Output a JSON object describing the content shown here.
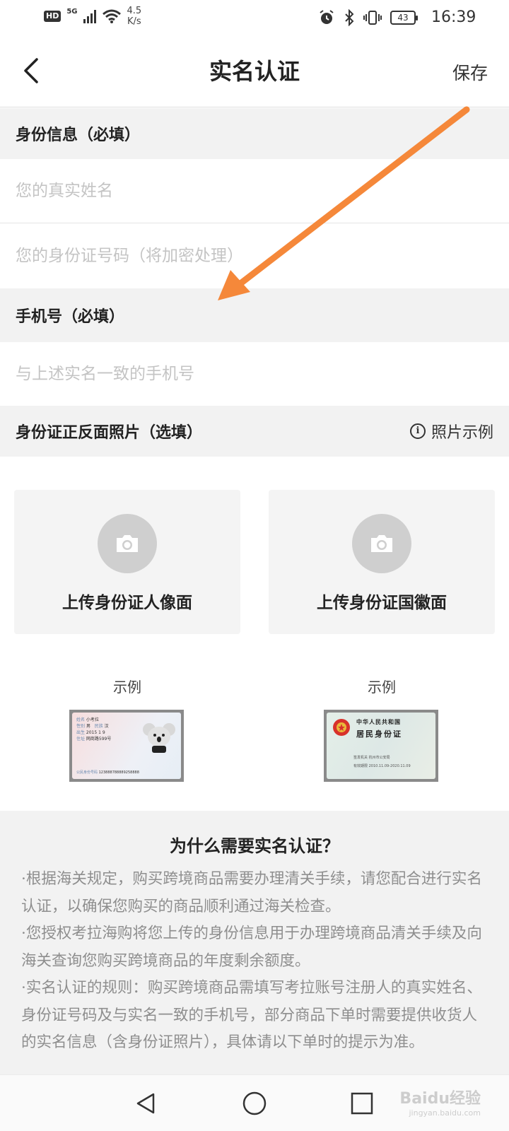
{
  "status_bar": {
    "hd": "HD",
    "network": "5G",
    "net_speed_value": "4.5",
    "net_speed_unit": "K/s",
    "battery": "43",
    "time": "16:39"
  },
  "header": {
    "title": "实名认证",
    "save_label": "保存"
  },
  "identity_section": {
    "label": "身份信息（必填）",
    "name_placeholder": "您的真实姓名",
    "id_placeholder": "您的身份证号码（将加密处理）"
  },
  "phone_section": {
    "label": "手机号（必填）",
    "phone_placeholder": "与上述实名一致的手机号"
  },
  "photo_section": {
    "label": "身份证正反面照片（选填）",
    "sample_link": "照片示例",
    "front_upload": "上传身份证人像面",
    "back_upload": "上传身份证国徽面",
    "example_label_front": "示例",
    "example_label_back": "示例"
  },
  "sample_front": {
    "name": "小考拉",
    "sex_label": "性别",
    "sex": "男",
    "ethnic_label": "民族",
    "ethnic": "汉",
    "birth": "2015  1  9",
    "address": "网商路599号",
    "id_label": "公民身份号码",
    "id_number": "123888788889258888"
  },
  "sample_back": {
    "line1": "中华人民共和国",
    "line2": "居民身份证",
    "authority": "签发机关  杭州市公安局",
    "validity": "有效期限  2010.11.09-2020.11.09"
  },
  "why_section": {
    "title": "为什么需要实名认证？",
    "paragraphs": [
      "·根据海关规定，购买跨境商品需要办理清关手续，请您配合进行实名认证，以确保您购买的商品顺利通过海关检查。",
      "·您授权考拉海购将您上传的身份信息用于办理跨境商品清关手续及向海关查询您购买跨境商品的年度剩余额度。",
      "·实名认证的规则：购买跨境商品需填写考拉账号注册人的真实姓名、身份证号码及与实名一致的手机号，部分商品下单时需要提供收货人的实名信息（含身份证照片），具体请以下单时的提示为准。"
    ]
  },
  "watermark": {
    "brand": "Baidu经验",
    "url": "jingyan.baidu.com"
  },
  "colors": {
    "arrow": "#f5883a",
    "section_bg": "#f2f2f2",
    "placeholder": "#c4c4c4",
    "muted_text": "#8e8e8e"
  },
  "icons": [
    "back-arrow-icon",
    "info-icon",
    "camera-icon",
    "nav-back-icon",
    "nav-home-icon",
    "nav-recent-icon"
  ]
}
